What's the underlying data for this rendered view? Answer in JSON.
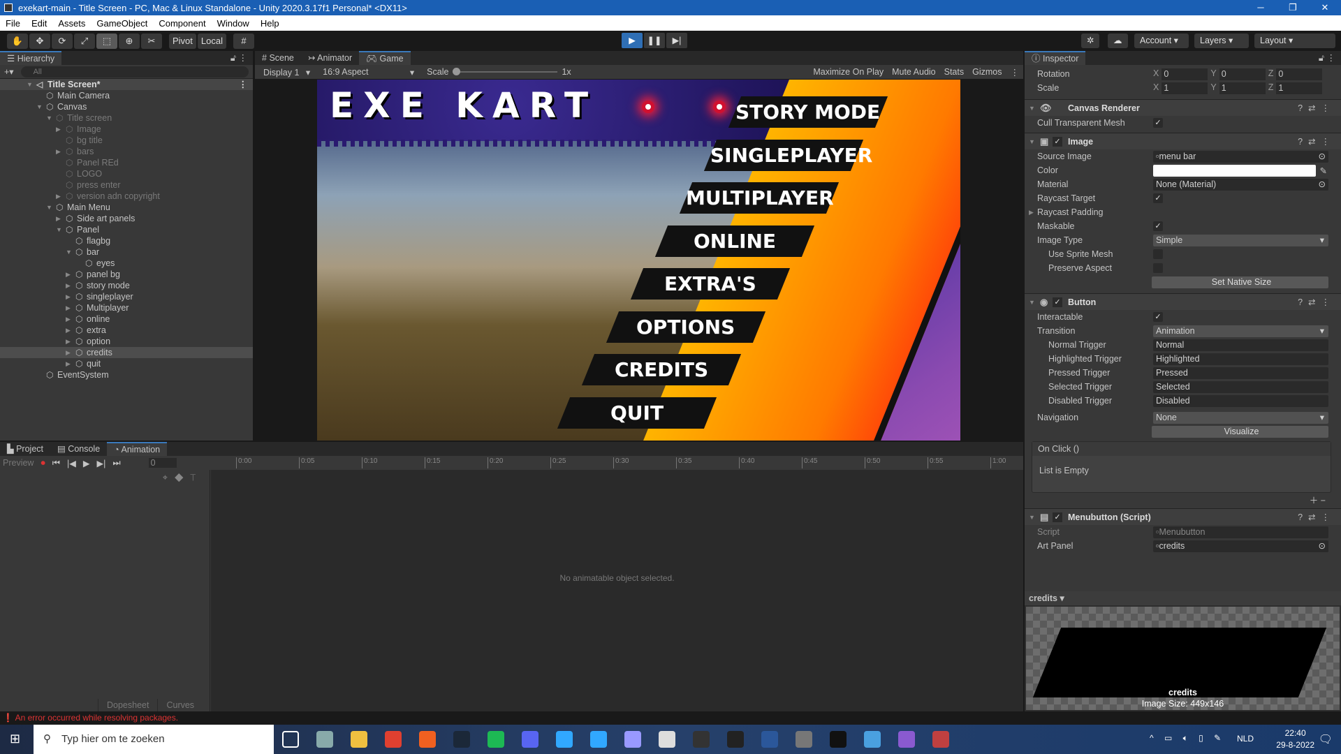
{
  "window": {
    "title": "exekart-main - Title Screen - PC, Mac & Linux Standalone - Unity 2020.3.17f1 Personal* <DX11>",
    "controls": [
      "minimize",
      "maximize",
      "close"
    ]
  },
  "menu": [
    "File",
    "Edit",
    "Assets",
    "GameObject",
    "Component",
    "Window",
    "Help"
  ],
  "toolbar": {
    "tools": [
      "hand",
      "move",
      "rotate",
      "scale",
      "rect",
      "transform",
      "custom"
    ],
    "pivot": "Pivot",
    "local": "Local",
    "account": "Account",
    "layers": "Layers",
    "layout": "Layout",
    "play_state": "playing"
  },
  "hierarchy": {
    "tab": "Hierarchy",
    "search_placeholder": "All",
    "items": [
      {
        "label": "Title Screen*",
        "depth": 0,
        "expand": "open",
        "scene": true
      },
      {
        "label": "Main Camera",
        "depth": 1,
        "expand": "none"
      },
      {
        "label": "Canvas",
        "depth": 1,
        "expand": "open"
      },
      {
        "label": "Title screen",
        "depth": 2,
        "expand": "open",
        "disabled": true
      },
      {
        "label": "Image",
        "depth": 3,
        "expand": "closed",
        "disabled": true
      },
      {
        "label": "bg title",
        "depth": 3,
        "expand": "none",
        "disabled": true
      },
      {
        "label": "bars",
        "depth": 3,
        "expand": "closed",
        "disabled": true
      },
      {
        "label": "Panel REd",
        "depth": 3,
        "expand": "none",
        "disabled": true
      },
      {
        "label": "LOGO",
        "depth": 3,
        "expand": "none",
        "disabled": true
      },
      {
        "label": "press enter",
        "depth": 3,
        "expand": "none",
        "disabled": true
      },
      {
        "label": "version adn copyright",
        "depth": 3,
        "expand": "closed",
        "disabled": true
      },
      {
        "label": "Main Menu",
        "depth": 2,
        "expand": "open"
      },
      {
        "label": "Side art panels",
        "depth": 3,
        "expand": "closed"
      },
      {
        "label": "Panel",
        "depth": 3,
        "expand": "open"
      },
      {
        "label": "flagbg",
        "depth": 4,
        "expand": "none"
      },
      {
        "label": "bar",
        "depth": 4,
        "expand": "open"
      },
      {
        "label": "eyes",
        "depth": 5,
        "expand": "none"
      },
      {
        "label": "panel bg",
        "depth": 4,
        "expand": "closed"
      },
      {
        "label": "story mode",
        "depth": 4,
        "expand": "closed"
      },
      {
        "label": "singleplayer",
        "depth": 4,
        "expand": "closed"
      },
      {
        "label": "Multiplayer",
        "depth": 4,
        "expand": "closed"
      },
      {
        "label": "online",
        "depth": 4,
        "expand": "closed"
      },
      {
        "label": "extra",
        "depth": 4,
        "expand": "closed"
      },
      {
        "label": "option",
        "depth": 4,
        "expand": "closed"
      },
      {
        "label": "credits",
        "depth": 4,
        "expand": "closed",
        "selected": true
      },
      {
        "label": "quit",
        "depth": 4,
        "expand": "closed"
      },
      {
        "label": "EventSystem",
        "depth": 1,
        "expand": "none"
      }
    ]
  },
  "game": {
    "tabs": [
      "Scene",
      "Animator",
      "Game"
    ],
    "active_tab": "Game",
    "display": "Display 1",
    "aspect": "16:9 Aspect",
    "scale_label": "Scale",
    "scale_value": "1x",
    "options": [
      "Maximize On Play",
      "Mute Audio",
      "Stats",
      "Gizmos"
    ],
    "logo": "EXE KART",
    "menu_buttons": [
      "STORY MODE",
      "SINGLEPLAYER",
      "MULTIPLAYER",
      "ONLINE",
      "EXTRA'S",
      "OPTIONS",
      "CREDITS",
      "QUIT"
    ]
  },
  "inspector": {
    "tab": "Inspector",
    "transform": {
      "rotation_label": "Rotation",
      "rotation": [
        "0",
        "0",
        "0"
      ],
      "scale_label": "Scale",
      "scale": [
        "1",
        "1",
        "1"
      ]
    },
    "canvas_renderer": {
      "title": "Canvas Renderer",
      "cull_label": "Cull Transparent Mesh",
      "cull": true
    },
    "image": {
      "title": "Image",
      "source_label": "Source Image",
      "source": "menu bar",
      "color_label": "Color",
      "color": "#ffffff",
      "material_label": "Material",
      "material": "None (Material)",
      "raycast_label": "Raycast Target",
      "raycast": true,
      "padding_label": "Raycast Padding",
      "maskable_label": "Maskable",
      "maskable": true,
      "type_label": "Image Type",
      "type": "Simple",
      "sprite_mesh_label": "Use Sprite Mesh",
      "sprite_mesh": false,
      "preserve_label": "Preserve Aspect",
      "preserve": false,
      "native_size": "Set Native Size"
    },
    "button": {
      "title": "Button",
      "interactable_label": "Interactable",
      "interactable": true,
      "transition_label": "Transition",
      "transition": "Animation",
      "triggers": [
        {
          "k": "Normal Trigger",
          "v": "Normal"
        },
        {
          "k": "Highlighted Trigger",
          "v": "Highlighted"
        },
        {
          "k": "Pressed Trigger",
          "v": "Pressed"
        },
        {
          "k": "Selected Trigger",
          "v": "Selected"
        },
        {
          "k": "Disabled Trigger",
          "v": "Disabled"
        }
      ],
      "navigation_label": "Navigation",
      "navigation": "None",
      "visualize": "Visualize",
      "onclick": "On Click ()",
      "list_empty": "List is Empty"
    },
    "menubutton": {
      "title": "Menubutton (Script)",
      "script_label": "Script",
      "script": "Menubutton",
      "art_label": "Art Panel",
      "art": "credits"
    },
    "preview": {
      "title": "credits",
      "name": "credits",
      "size": "Image Size: 449x146"
    }
  },
  "bottom": {
    "tabs": [
      "Project",
      "Console",
      "Animation"
    ],
    "active_tab": "Animation",
    "preview": "Preview",
    "frame": "0",
    "ticks": [
      "0:00",
      "0:05",
      "0:10",
      "0:15",
      "0:20",
      "0:25",
      "0:30",
      "0:35",
      "0:40",
      "0:45",
      "0:50",
      "0:55",
      "1:00"
    ],
    "empty": "No animatable object selected.",
    "modes": [
      "Dopesheet",
      "Curves"
    ]
  },
  "status": {
    "error": "An error occurred while resolving packages."
  },
  "taskbar": {
    "search_placeholder": "Typ hier om te zoeken",
    "apps": [
      "task-view",
      "explorer-alt",
      "file-explorer",
      "chrome",
      "origin",
      "steam",
      "spotify",
      "discord",
      "photoshop",
      "photoshop-2",
      "premiere",
      "app",
      "obs",
      "logitech",
      "word",
      "app-2",
      "unity",
      "photos",
      "visual-studio",
      "media"
    ],
    "lang": "NLD",
    "time": "22:40",
    "date": "29-8-2022"
  }
}
